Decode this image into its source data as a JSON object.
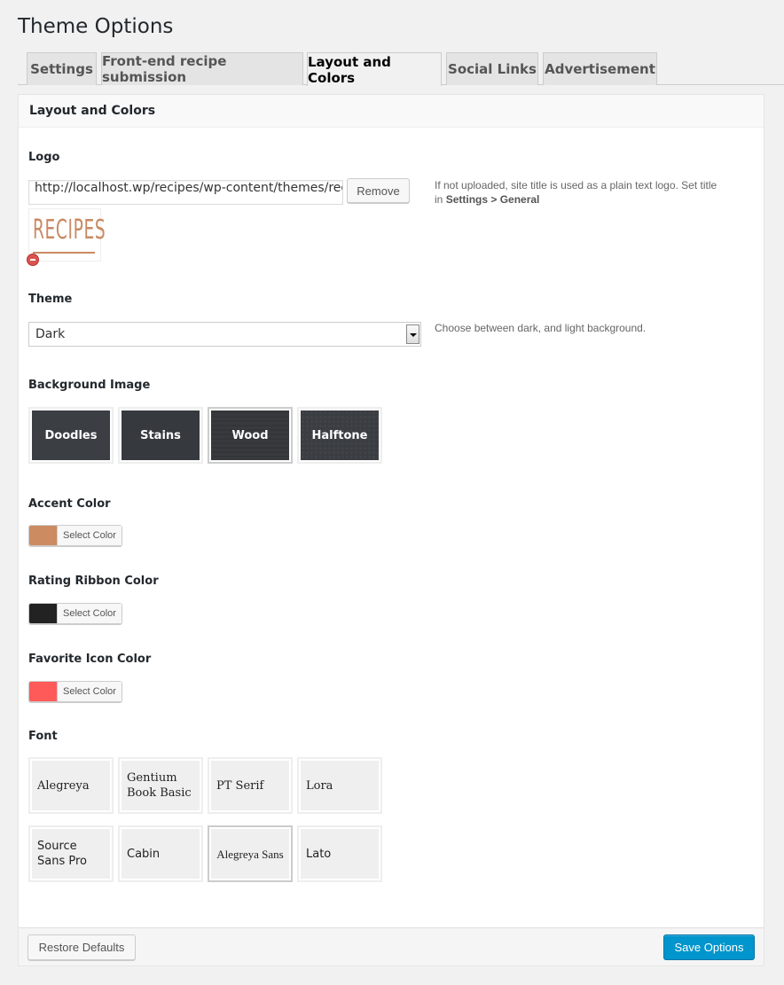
{
  "page": {
    "title": "Theme Options"
  },
  "tabs": [
    {
      "label": "Settings",
      "active": false
    },
    {
      "label": "Front-end recipe submission",
      "active": false
    },
    {
      "label": "Layout and Colors",
      "active": true
    },
    {
      "label": "Social Links",
      "active": false
    },
    {
      "label": "Advertisement",
      "active": false
    }
  ],
  "panel": {
    "title": "Layout and Colors",
    "logo": {
      "label": "Logo",
      "url_value": "http://localhost.wp/recipes/wp-content/themes/recipes/images/logo.png",
      "remove_label": "Remove",
      "preview_text": "RECIPES",
      "desc_prefix": "If not uploaded, site title is used as a plain text logo. Set title in ",
      "desc_bold": "Settings > General"
    },
    "theme": {
      "label": "Theme",
      "selected": "Dark",
      "desc": "Choose between dark, and light background."
    },
    "background_image": {
      "label": "Background Image",
      "options": [
        "Doodles",
        "Stains",
        "Wood",
        "Halftone"
      ],
      "selected": "Wood"
    },
    "accent_color": {
      "label": "Accent Color",
      "color": "#cc8b60",
      "button_label": "Select Color"
    },
    "rating_ribbon_color": {
      "label": "Rating Ribbon Color",
      "color": "#222222",
      "button_label": "Select Color"
    },
    "favorite_icon_color": {
      "label": "Favorite Icon Color",
      "color": "#fe5a5a",
      "button_label": "Select Color"
    },
    "font": {
      "label": "Font",
      "options": [
        "Alegreya",
        "Gentium Book Basic",
        "PT Serif",
        "Lora",
        "Source Sans Pro",
        "Cabin",
        "Alegreya Sans",
        "Lato"
      ],
      "selected": "Alegreya Sans"
    }
  },
  "footer": {
    "restore_label": "Restore Defaults",
    "save_label": "Save Options"
  },
  "colors": {
    "primary_button": "#0095cc",
    "tab_bg": "#e4e4e4",
    "page_bg": "#f1f1f1"
  }
}
